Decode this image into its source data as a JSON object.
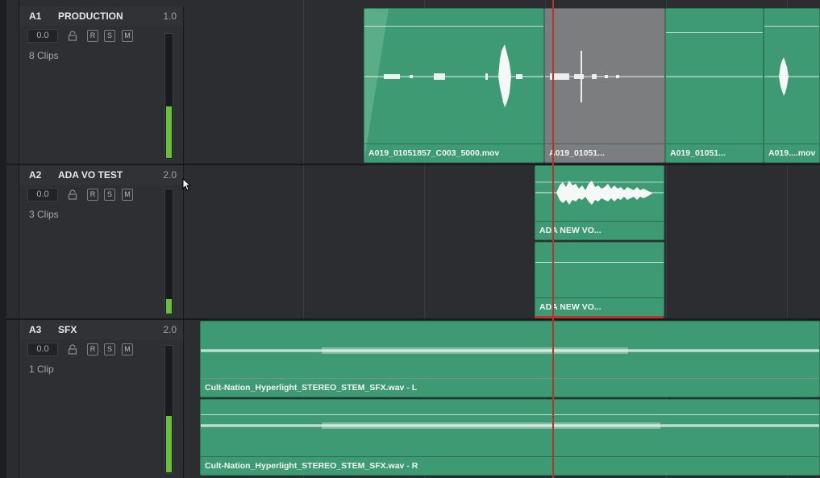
{
  "tracks": [
    {
      "id": "A1",
      "name": "PRODUCTION",
      "format": "1.0",
      "volume": "0.0",
      "clip_count": "8 Clips",
      "meter_level": 0.42,
      "buttons": [
        "R",
        "S",
        "M"
      ]
    },
    {
      "id": "A2",
      "name": "ADA VO TEST",
      "format": "2.0",
      "volume": "0.0",
      "clip_count": "3 Clips",
      "meter_level": 0.12,
      "buttons": [
        "R",
        "S",
        "M"
      ]
    },
    {
      "id": "A3",
      "name": "SFX",
      "format": "2.0",
      "volume": "0.0",
      "clip_count": "1 Clip",
      "meter_level": 0.45,
      "buttons": [
        "R",
        "S",
        "M"
      ]
    }
  ],
  "clips": {
    "a1_c1": "A019_01051857_C003_5000.mov",
    "a1_c2": "A019_01051...",
    "a1_c3": "A019_01051...",
    "a1_c4": "A019....mov",
    "a2_c1": "ADA NEW VO...",
    "a2_c2": "ADA NEW VO...",
    "a3_l": "Cult-Nation_Hyperlight_STEREO_STEM_SFX.wav - L",
    "a3_r": "Cult-Nation_Hyperlight_STEREO_STEM_SFX.wav - R"
  },
  "colors": {
    "clip": "#3d9a72",
    "selected_clip": "#7b7d7f",
    "playhead": "#b8322f",
    "meter": "#67bf3c"
  },
  "icons": [
    "lock-icon",
    "mouse-cursor-icon"
  ]
}
